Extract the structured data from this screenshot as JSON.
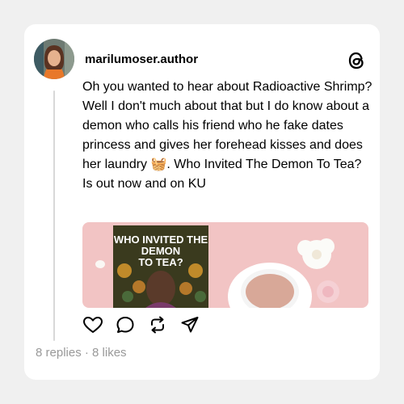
{
  "post": {
    "username": "marilumoser.author",
    "text": "Oh you wanted to hear about Radioactive Shrimp? Well I don't much about that but I do know about a demon who calls his friend who he fake dates princess and gives her forehead kisses and does her laundry 🧺. Who Invited The Demon To Tea? Is out now and on KU",
    "book_title_line1": "WHO INVITED THE",
    "book_title_line2": "DEMON",
    "book_title_line3": "TO TEA?",
    "stats": "8 replies · 8 likes"
  },
  "icons": {
    "logo": "threads-logo-icon",
    "like": "heart-icon",
    "reply": "comment-bubble-icon",
    "repost": "repost-arrows-icon",
    "share": "send-icon"
  },
  "colors": {
    "background": "#f0f0f0",
    "card": "#ffffff",
    "text": "#000000",
    "muted": "#999999",
    "media_pink": "#f2c4c4"
  }
}
